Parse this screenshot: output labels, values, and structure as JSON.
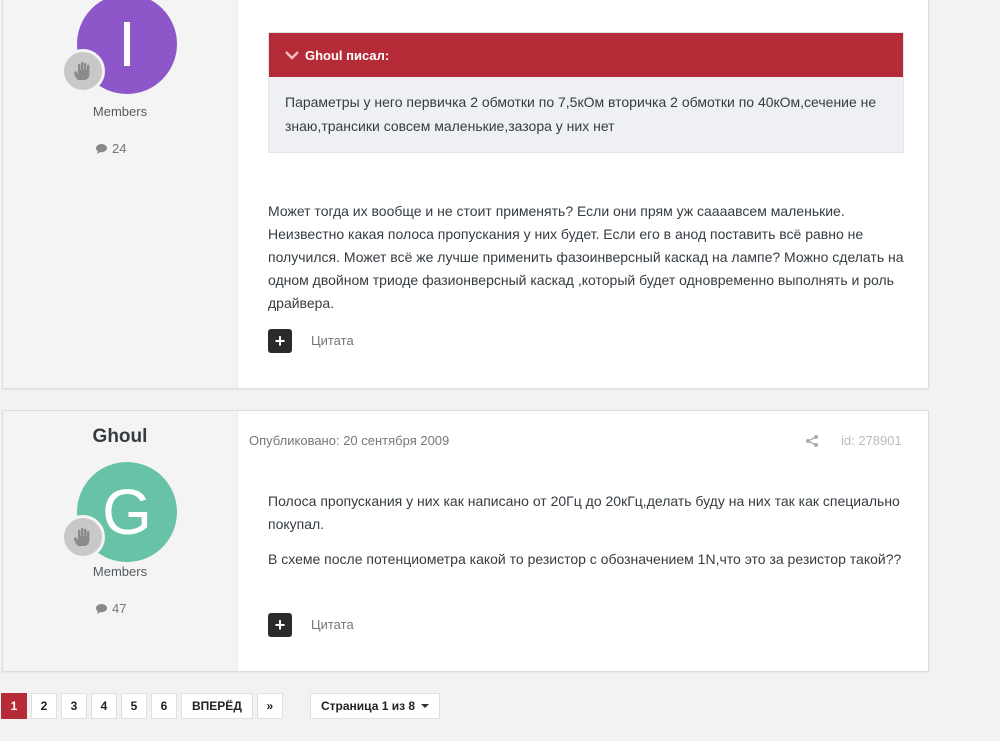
{
  "posts": [
    {
      "author": {
        "initial": "I",
        "avatar_color": "#8e57c9",
        "group": "Members",
        "post_count": "24"
      },
      "quote": {
        "header": "Ghoul писал:",
        "text": "Параметры у него первичка 2 обмотки по 7,5кОм вторичка 2 обмотки по 40кОм,сечение не знаю,трансики совсем маленькие,зазора у них нет"
      },
      "paragraphs": [
        "Может тогда их вообще и не стоит применять? Если они прям уж саааавсем маленькие. Неизвестно какая полоса пропускания у них будет. Если его в анод поставить всё равно не получился. Может всё же лучше применить фазоинверсный каскад на лампе? Можно сделать на одном двойном триоде фазионверсный каскад ,который будет одновременно выполнять и роль драйвера."
      ],
      "plus_label": "+",
      "quote_label": "Цитата"
    },
    {
      "author": {
        "name": "Ghoul",
        "initial": "G",
        "avatar_color": "#67c2a8",
        "group": "Members",
        "post_count": "47"
      },
      "published": "Опубликовано: 20 сентября 2009",
      "post_id": "id: 278901",
      "paragraphs": [
        "Полоса пропускания у них как написано от 20Гц до 20кГц,делать буду на них так как специально покупал.",
        "В схеме после потенциометра какой то резистор с обозначением 1N,что это за резистор такой??"
      ],
      "plus_label": "+",
      "quote_label": "Цитата"
    }
  ],
  "pagination": {
    "pages": [
      "1",
      "2",
      "3",
      "4",
      "5",
      "6"
    ],
    "current": "1",
    "next_label": "ВПЕРЁД",
    "last_label": "»",
    "page_jump": "Страница 1 из 8"
  },
  "colors": {
    "accent": "#b52b38",
    "quote_bg": "#eef0f4"
  }
}
